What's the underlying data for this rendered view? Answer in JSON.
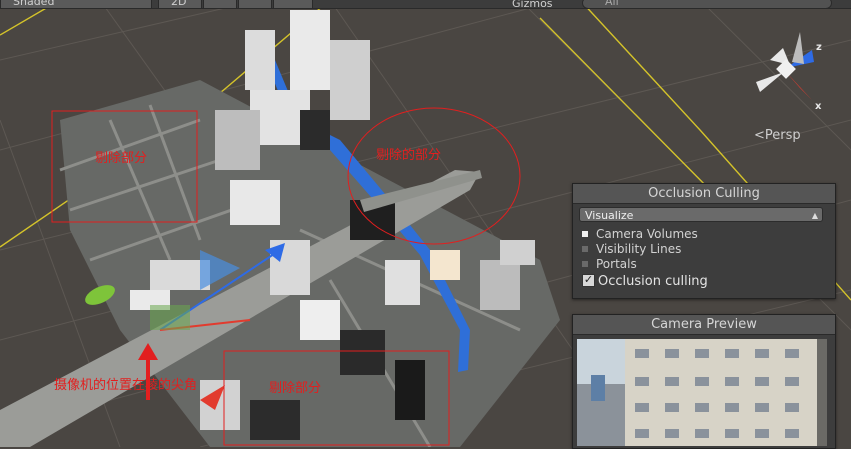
{
  "toolbar": {
    "shading_mode": "Shaded",
    "mode_2d": "2D",
    "gizmos_label": "Gizmos",
    "search_placeholder": "All"
  },
  "orientation_gizmo": {
    "axis_z": "z",
    "axis_x": "x",
    "projection_label": "<Persp"
  },
  "occlusion_panel": {
    "title": "Occlusion Culling",
    "visualize_value": "Visualize",
    "options": [
      {
        "label": "Camera Volumes",
        "enabled": true
      },
      {
        "label": "Visibility Lines",
        "enabled": false
      },
      {
        "label": "Portals",
        "enabled": false
      }
    ],
    "occlusion_toggle_label": "Occlusion culling",
    "occlusion_toggle_checked": true
  },
  "camera_preview": {
    "title": "Camera Preview"
  },
  "annotations": {
    "culled_left": "剔除部分",
    "culled_right": "剔除的部分",
    "camera_position": "摄像机的位置在棱的尖角",
    "culled_bottom": "剔除部分"
  },
  "colors": {
    "annotation_red": "#e21f1f",
    "grid_yellow": "#d4c32a",
    "river_blue": "#2f6fd8"
  }
}
